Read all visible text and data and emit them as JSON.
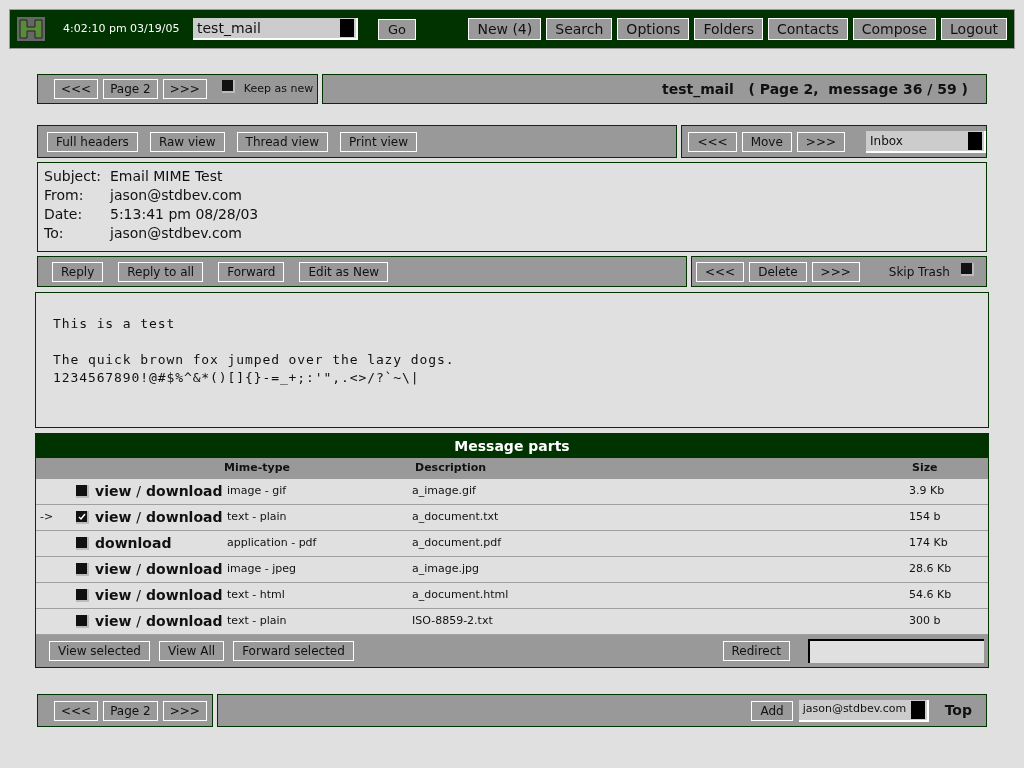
{
  "topbar": {
    "time": "4:02:10 pm 03/19/05",
    "folder": "test_mail",
    "go": "Go",
    "nav": [
      "New (4)",
      "Search",
      "Options",
      "Folders",
      "Contacts",
      "Compose",
      "Logout"
    ]
  },
  "pager_top": {
    "prev": "<<<",
    "page": "Page 2",
    "next": ">>>",
    "keep_as_new": {
      "label": "Keep as new",
      "checked": false
    }
  },
  "title": "test_mail   ( Page 2,  message 36 / 59 )",
  "view_buttons": [
    "Full headers",
    "Raw view",
    "Thread view",
    "Print view"
  ],
  "move": {
    "prev": "<<<",
    "move": "Move",
    "next": ">>>",
    "folder": "Inbox"
  },
  "headers": [
    {
      "label": "Subject:",
      "value": "Email MIME Test"
    },
    {
      "label": "From:",
      "value": "jason@stdbev.com"
    },
    {
      "label": "Date:",
      "value": "5:13:41 pm 08/28/03"
    },
    {
      "label": "To:",
      "value": "jason@stdbev.com"
    }
  ],
  "reply_buttons": [
    "Reply",
    "Reply to all",
    "Forward",
    "Edit as New"
  ],
  "delete": {
    "prev": "<<<",
    "delete": "Delete",
    "next": ">>>",
    "skip_trash": {
      "label": "Skip Trash",
      "checked": false
    }
  },
  "body": [
    [
      "This is a test"
    ],
    [
      "The quick brown fox jumped over the lazy dogs.",
      "1234567890!@#$%^&*()[]{}-=_+;:'\",.<>/?`~\\|"
    ]
  ],
  "parts": {
    "title": "Message parts",
    "columns": [
      "Mime-type",
      "Description",
      "Size"
    ],
    "separator": "/",
    "rows": [
      {
        "checked": false,
        "links": [
          "view",
          "download"
        ],
        "mime": "image - gif",
        "description": "a_image.gif",
        "size": "3.9 Kb"
      },
      {
        "pointer": "->",
        "checked": true,
        "links": [
          "view",
          "download"
        ],
        "mime": "text - plain",
        "description": "a_document.txt",
        "size": "154 b"
      },
      {
        "checked": false,
        "links": [
          "download"
        ],
        "mime": "application - pdf",
        "description": "a_document.pdf",
        "size": "174 Kb"
      },
      {
        "checked": false,
        "links": [
          "view",
          "download"
        ],
        "mime": "image - jpeg",
        "description": "a_image.jpg",
        "size": "28.6 Kb"
      },
      {
        "checked": false,
        "links": [
          "view",
          "download"
        ],
        "mime": "text - html",
        "description": "a_document.html",
        "size": "54.6 Kb"
      },
      {
        "checked": false,
        "links": [
          "view",
          "download"
        ],
        "mime": "text - plain",
        "description": "ISO-8859-2.txt",
        "size": "300 b"
      }
    ],
    "buttons": [
      "View selected",
      "View All",
      "Forward selected"
    ],
    "redirect": "Redirect"
  },
  "pager_bottom": {
    "prev": "<<<",
    "page": "Page 2",
    "next": ">>>",
    "add": "Add",
    "contact": "jason@stdbev.com",
    "top": "Top"
  }
}
